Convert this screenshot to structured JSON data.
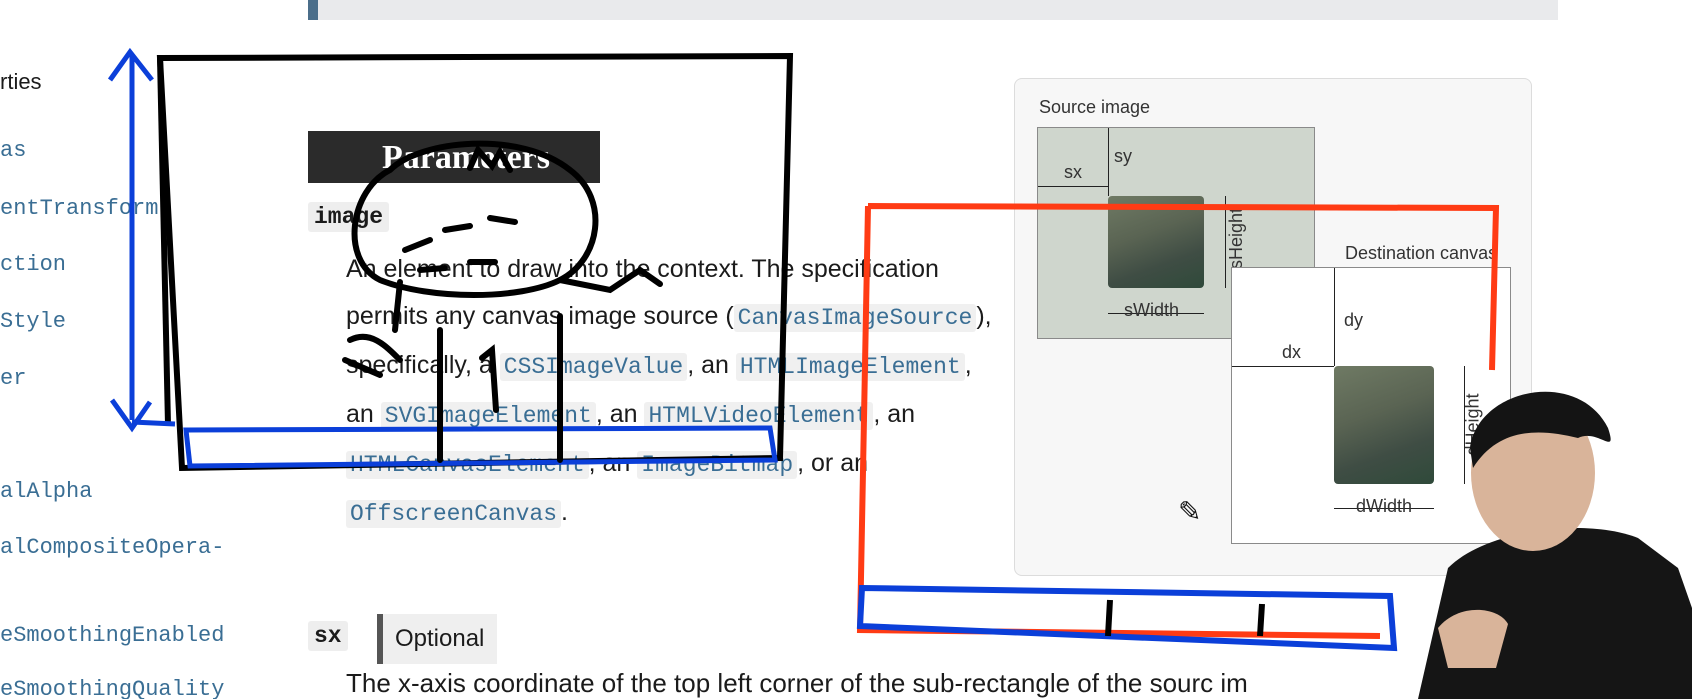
{
  "sidebar": {
    "items": [
      {
        "label": "rties",
        "style": "plain"
      },
      {
        "label": "as",
        "style": "code"
      },
      {
        "label": "entTransform",
        "style": "code"
      },
      {
        "label": "ction",
        "style": "code"
      },
      {
        "label": "Style",
        "style": "code"
      },
      {
        "label": "er",
        "style": "code"
      },
      {
        "label": "alAlpha",
        "style": "code"
      },
      {
        "label": "alCompositeOpera-",
        "style": "code"
      },
      {
        "label": "eSmoothingEnabled",
        "style": "code"
      },
      {
        "label": "eSmoothingQuality",
        "style": "code"
      }
    ]
  },
  "main": {
    "section_title": "Parameters",
    "param_image": "image",
    "image_description": {
      "t1": "An element to draw into the context. The specification permits any canvas image source (",
      "c1": "CanvasImageSource",
      "t2": "), specifically, a ",
      "c2": "CSSImageValue",
      "t3": ", an ",
      "c3": "HTMLImageElement",
      "t4": ", an ",
      "c4": "SVGImageElement",
      "t5": ", an ",
      "c5": "HTMLVideoElement",
      "t6": ", an ",
      "c6": "HTMLCanvasElement",
      "t7": ", an ",
      "c7": "ImageBitmap",
      "t8": ", or an ",
      "c8": "OffscreenCanvas",
      "t9": "."
    },
    "param_sx": "sx",
    "optional_label": "Optional",
    "sx_description": "The x-axis coordinate of the top left corner of the sub-rectangle of the sourc   im"
  },
  "diagram": {
    "source_title": "Source image",
    "destination_title": "Destination canvas",
    "labels": {
      "sx": "sx",
      "sy": "sy",
      "sHeight": "sHeight",
      "sWidth": "sWidth",
      "dx": "dx",
      "dy": "dy",
      "dHeight": "dHeight",
      "dWidth": "dWidth"
    }
  },
  "annotations": {
    "colors": {
      "black_box": "#000000",
      "blue_marks": "#0b3fd9",
      "red_box": "#ff3b14"
    },
    "doodle_label": "1"
  },
  "icons": [
    "pencil-icon"
  ]
}
